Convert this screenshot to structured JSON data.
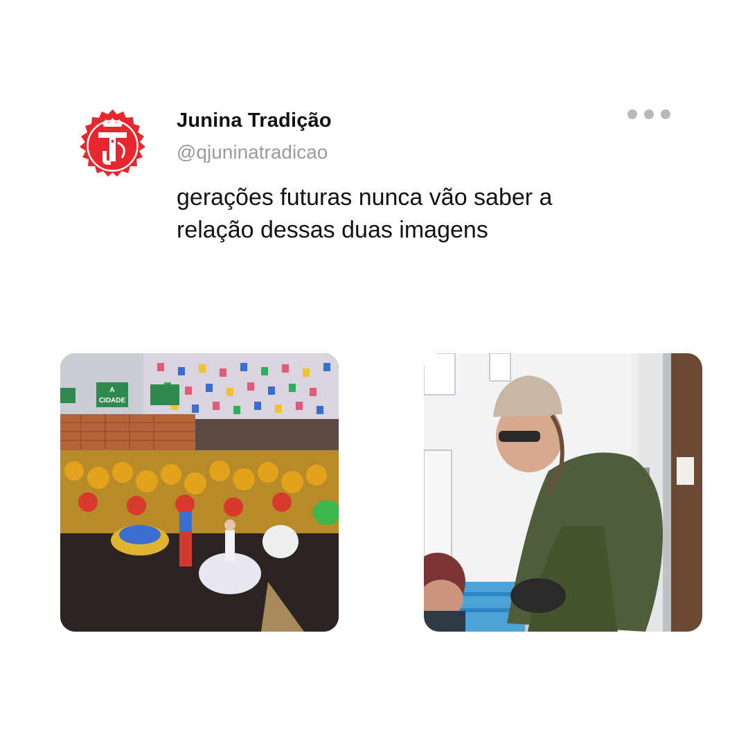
{
  "tweet": {
    "display_name": "Junina Tradição",
    "handle": "@qjuninatradicao",
    "text_lines": [
      "gerações futuras nunca vão saber a",
      "relação dessas duas imagens"
    ],
    "avatar": {
      "letters": "JT",
      "color": "#e8262d"
    },
    "more_icon": "more-horizontal-icon"
  },
  "media": [
    {
      "label": "cidade",
      "signs": [
        "A",
        "CIDADE"
      ]
    },
    {}
  ]
}
